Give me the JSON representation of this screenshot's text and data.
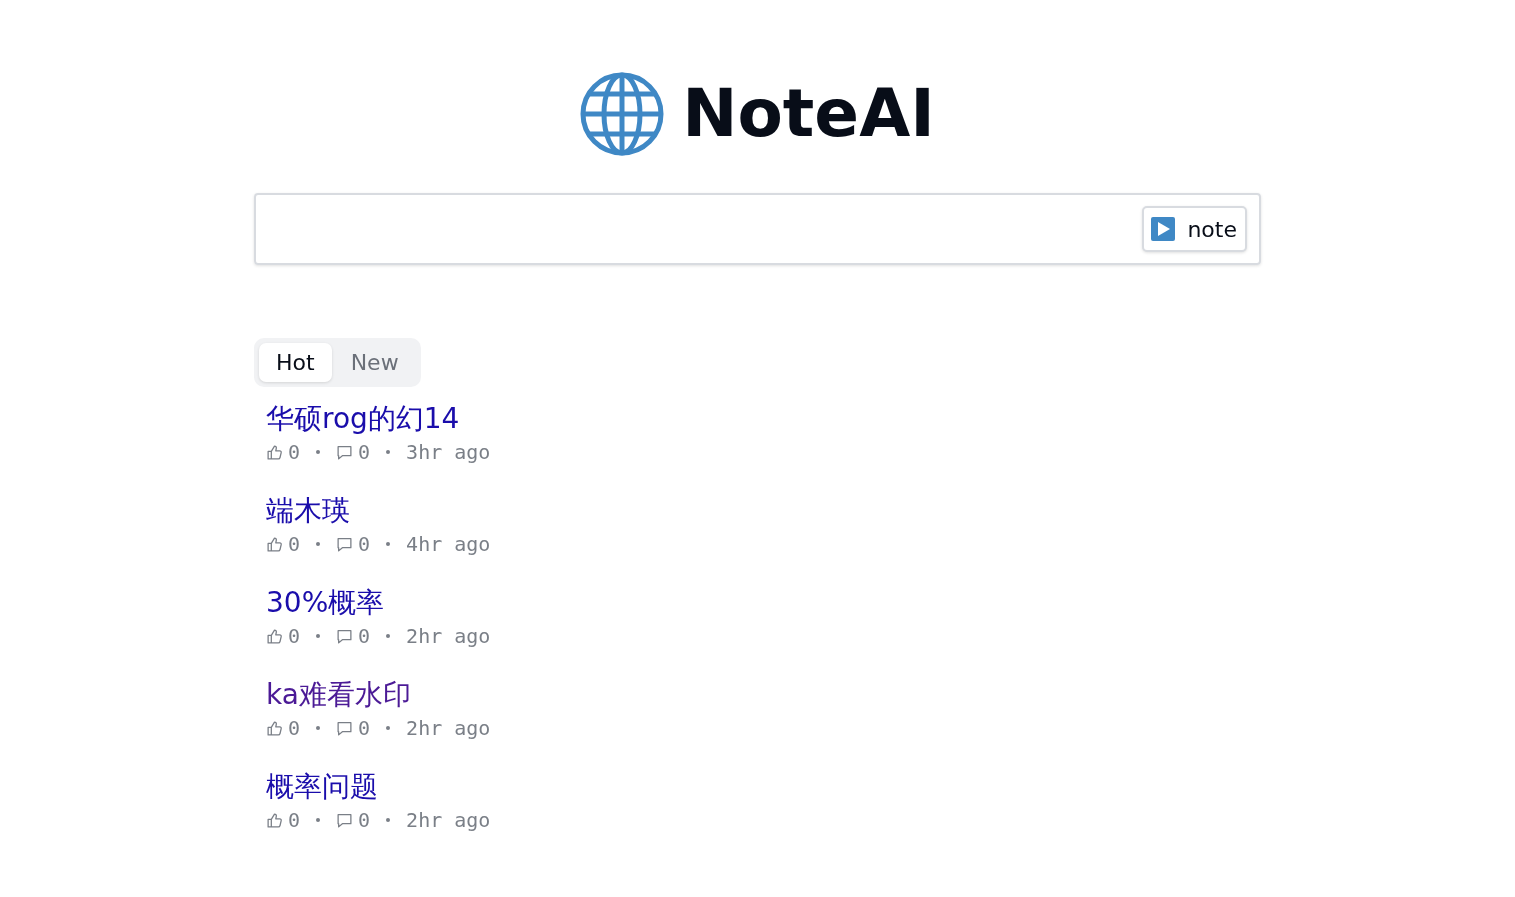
{
  "logo": {
    "title": "NoteAI"
  },
  "search": {
    "button": "note"
  },
  "tabs": [
    {
      "label": "Hot",
      "selected": true
    },
    {
      "label": "New",
      "selected": false
    }
  ],
  "posts": [
    {
      "title": "华硕rog的幻14",
      "visited": false,
      "likes": "0",
      "comments": "0",
      "time": "3hr ago"
    },
    {
      "title": "端木瑛",
      "visited": false,
      "likes": "0",
      "comments": "0",
      "time": "4hr ago"
    },
    {
      "title": "30%概率",
      "visited": false,
      "likes": "0",
      "comments": "0",
      "time": "2hr ago"
    },
    {
      "title": "ka难看水印",
      "visited": true,
      "likes": "0",
      "comments": "0",
      "time": "2hr ago"
    },
    {
      "title": "概率问题",
      "visited": false,
      "likes": "0",
      "comments": "0",
      "time": "2hr ago"
    }
  ]
}
